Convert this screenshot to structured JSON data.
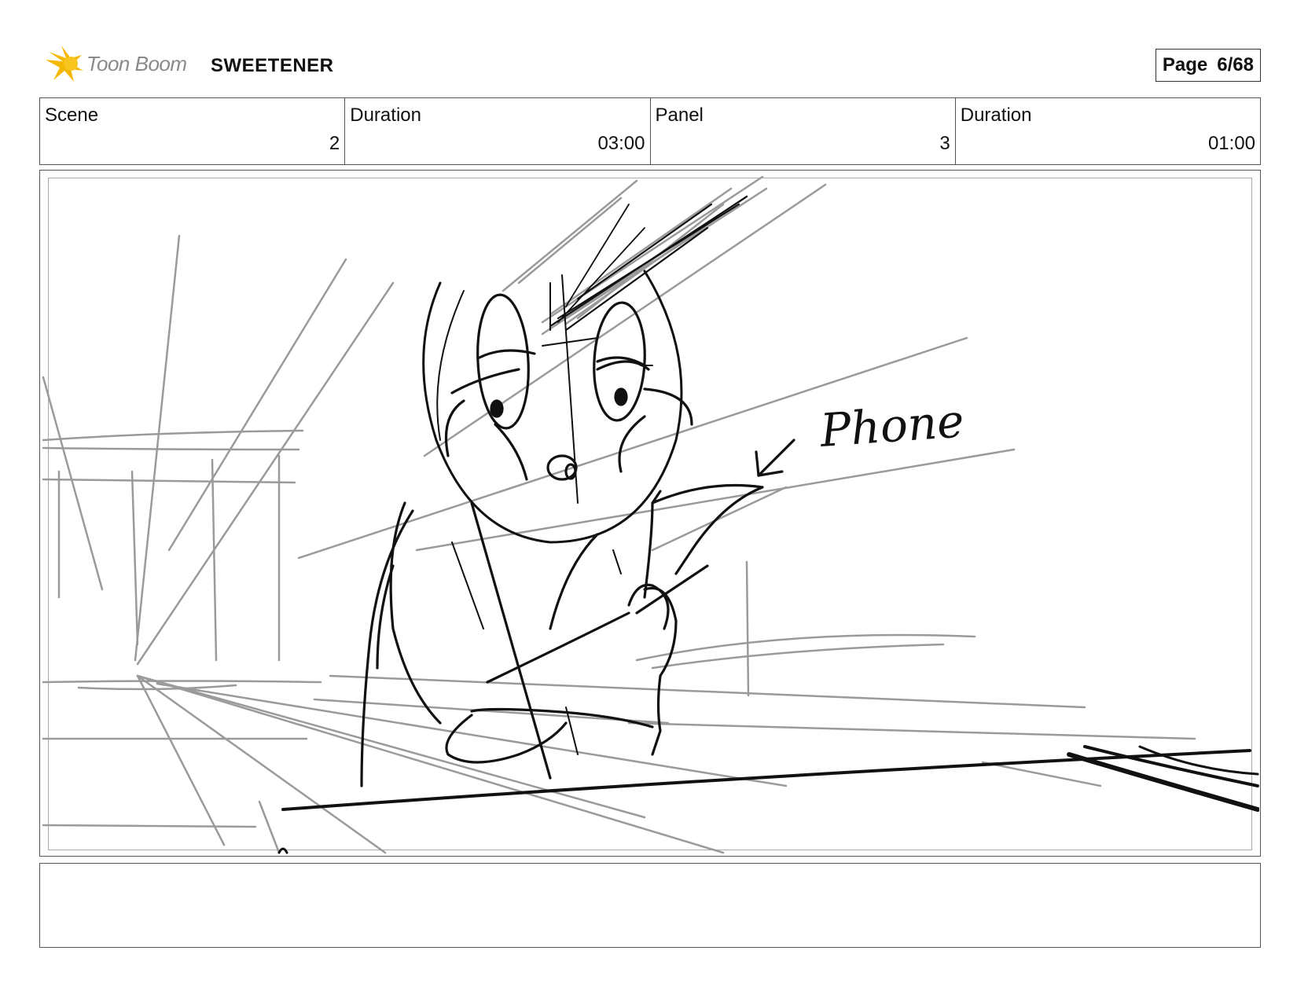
{
  "header": {
    "logo_text": "Toon Boom",
    "project_title": "SWEETENER",
    "page_label": "Page",
    "page_value": "6/68"
  },
  "info": {
    "scene_label": "Scene",
    "scene_value": "2",
    "scene_duration_label": "Duration",
    "scene_duration_value": "03:00",
    "panel_label": "Panel",
    "panel_value": "3",
    "panel_duration_label": "Duration",
    "panel_duration_value": "01:00"
  },
  "panel": {
    "annotation_text": "Phone"
  },
  "caption": {
    "text": ""
  },
  "colors": {
    "logo_accent": "#f5b800",
    "sketch_dark": "#111111",
    "sketch_light": "#9a9a9a"
  },
  "icons": [
    "toon-boom-logo-icon"
  ]
}
